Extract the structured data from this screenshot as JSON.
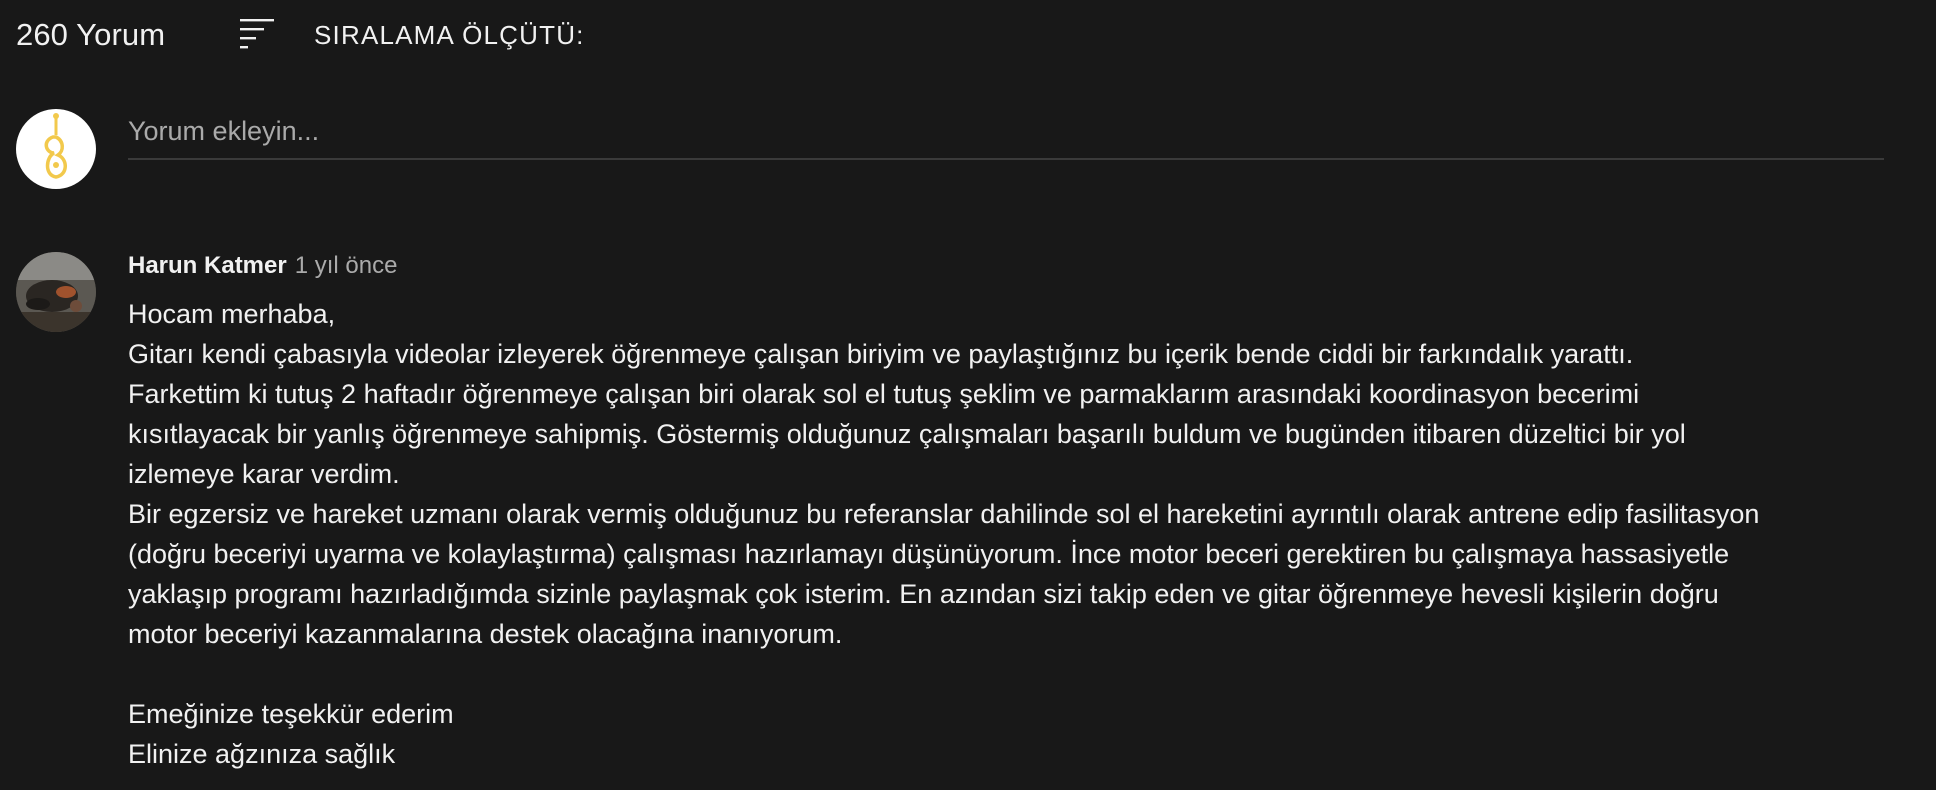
{
  "header": {
    "comment_count": "260 Yorum",
    "sort_label": "SIRALAMA ÖLÇÜTÜ:"
  },
  "add_comment": {
    "placeholder": "Yorum ekleyin..."
  },
  "comment": {
    "author": "Harun Katmer",
    "time": "1 yıl önce",
    "lines": [
      "Hocam merhaba,",
      "Gitarı kendi çabasıyla videolar izleyerek öğrenmeye çalışan biriyim ve paylaştığınız bu içerik bende ciddi bir farkındalık yarattı.",
      "Farkettim ki tutuş 2 haftadır öğrenmeye çalışan biri olarak sol el tutuş şeklim ve parmaklarım arasındaki koordinasyon becerimi",
      "kısıtlayacak bir yanlış öğrenmeye sahipmiş. Göstermiş olduğunuz çalışmaları başarılı buldum ve bugünden itibaren düzeltici bir yol",
      "izlemeye karar verdim.",
      "Bir egzersiz ve hareket uzmanı olarak vermiş olduğunuz bu referanslar dahilinde sol el hareketini ayrıntılı olarak antrene edip fasilitasyon",
      "(doğru beceriyi uyarma ve kolaylaştırma) çalışması hazırlamayı düşünüyorum. İnce motor beceri gerektiren bu çalışmaya hassasiyetle",
      "yaklaşıp programı hazırladığımda sizinle paylaşmak çok isterim. En azından sizi takip eden ve gitar öğrenmeye hevesli kişilerin doğru",
      "motor beceriyi kazanmalarına destek olacağına inanıyorum.",
      "",
      "Emeğinize teşekkür ederim",
      "Elinize ağzınıza sağlık"
    ]
  },
  "icons": {
    "sort": "sort-icon",
    "self_avatar": "guitar-logo-avatar",
    "user_avatar": "user-photo-avatar"
  },
  "colors": {
    "background": "#181818",
    "text_primary": "#f1f1f1",
    "text_secondary": "#aaaaaa",
    "input_underline": "#3a3a3a",
    "logo_yellow": "#f2c94c"
  }
}
